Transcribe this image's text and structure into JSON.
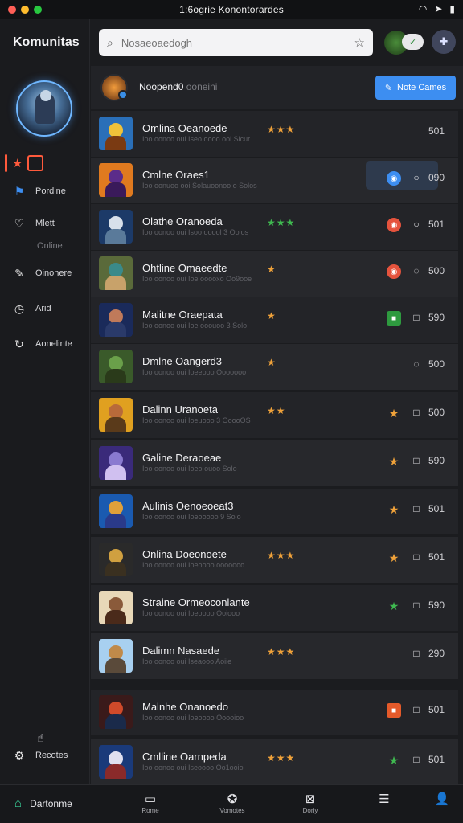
{
  "statusbar": {
    "title": "1:6ogrie Konontorardes"
  },
  "sidebar": {
    "title": "Komunitas",
    "items": [
      {
        "label": "Pordine",
        "icon": "flag-icon"
      },
      {
        "label": "Mlett",
        "icon": "heart-icon"
      },
      {
        "label": "Oinonere",
        "icon": "chat-icon"
      },
      {
        "label": "Arid",
        "icon": "clock-icon"
      },
      {
        "label": "Aonelinte",
        "icon": "refresh-icon"
      },
      {
        "label": "Recotes",
        "icon": "settings-icon"
      }
    ],
    "sub_label": "Online"
  },
  "search": {
    "placeholder": "Nosaeoaedogh"
  },
  "profile": {
    "name": "Noopend0",
    "status": "ooneini",
    "button_label": "Note Cames"
  },
  "rows": [
    {
      "title": "Omlina Oeanoede",
      "subtitle": "Ioo oonoo oui Iseo oooo ooi Sicur",
      "stars": "★★★",
      "star_color": "#f0a23a",
      "marker": "",
      "marker_color": "",
      "action": "",
      "count": "501"
    },
    {
      "title": "Cmlne Oraes1",
      "subtitle": "Ioo oonuoo ooi Solauoonoo o Solos",
      "stars": "",
      "star_color": "#f0a23a",
      "marker": "◉",
      "marker_color": "#3d8ef1",
      "action": "○",
      "count": "090"
    },
    {
      "title": "Olathe Oranoeda",
      "subtitle": "Ioo oonoo oui Isoo ooool 3 Ooios",
      "stars": "★★★",
      "star_color": "#3fb950",
      "marker": "◉",
      "marker_color": "#e5533d",
      "action": "○",
      "count": "501"
    },
    {
      "title": "Ohtline Omaeedte",
      "subtitle": "Ioo oonoo oui Ioe ooooxo Oo9ooe",
      "stars": "★",
      "star_color": "#f0a23a",
      "marker": "◉",
      "marker_color": "#e5533d",
      "action": "◌",
      "count": "500"
    },
    {
      "title": "Malitne Oraepata",
      "subtitle": "Ioo oonoo oui Ioe ooouoo 3 Solo",
      "stars": "★",
      "star_color": "#f0a23a",
      "marker": "■",
      "marker_color": "#2e9a3f",
      "action": "□",
      "count": "590"
    },
    {
      "title": "Dmlne Oangerd3",
      "subtitle": "Ioo oonoo oui Ioeeooo Ooooooo",
      "stars": "★",
      "star_color": "#f0a23a",
      "marker": "",
      "marker_color": "",
      "action": "◌",
      "count": "500"
    },
    {
      "title": "Dalinn Uranoeta",
      "subtitle": "Ioo oonoo oui Ioeuooo 3 OoooOS",
      "stars": "★★",
      "star_color": "#f0a23a",
      "marker": "★",
      "marker_color": "#f0a23a",
      "action": "□",
      "count": "500"
    },
    {
      "title": "Galine Deraoeae",
      "subtitle": "Ioo oonoo oui Ioeo ouoo Solo",
      "stars": "",
      "star_color": "#f0a23a",
      "marker": "★",
      "marker_color": "#f0a23a",
      "action": "□",
      "count": "590"
    },
    {
      "title": "Aulinis Oenoeoeat3",
      "subtitle": "Ioo oonoo oui Ioeooooo 9 Solo",
      "stars": "",
      "star_color": "#f0a23a",
      "marker": "★",
      "marker_color": "#f0a23a",
      "action": "□",
      "count": "501"
    },
    {
      "title": "Onlina Doeonoete",
      "subtitle": "Ioo oonoo oui Ioeoooo ooooooo",
      "stars": "★★★",
      "star_color": "#f0a23a",
      "marker": "★",
      "marker_color": "#f0a23a",
      "action": "□",
      "count": "501"
    },
    {
      "title": "Straine Ormeoconlante",
      "subtitle": "Ioo oonoo oui Ioeoooo Ooiooo",
      "stars": "",
      "star_color": "#f0a23a",
      "marker": "★",
      "marker_color": "#3fb950",
      "action": "□",
      "count": "590"
    },
    {
      "title": "Dalimn Nasaede",
      "subtitle": "Ioo oonoo oui Iseaooo Aoiie",
      "stars": "★★★",
      "star_color": "#f0a23a",
      "marker": "",
      "marker_color": "",
      "action": "□",
      "count": "290"
    },
    {
      "title": "Malnhe Onanoedo",
      "subtitle": "Ioo oonoo oui Ioeoooo Ooooioo",
      "stars": "",
      "star_color": "#f0a23a",
      "marker": "■",
      "marker_color": "#e55a2a",
      "action": "□",
      "count": "501"
    },
    {
      "title": "Cmlline Oarnpeda",
      "subtitle": "Ioo oonoo oui Iseoooo Oo1ooio",
      "stars": "★★★",
      "star_color": "#f0a23a",
      "marker": "★",
      "marker_color": "#3fb950",
      "action": "□",
      "count": "501"
    }
  ],
  "thumb_colors": [
    [
      "#2a6fb8",
      "#f0c23a",
      "#7a3a12"
    ],
    [
      "#e07a1f",
      "#5b2c8a",
      "#3a1a5a"
    ],
    [
      "#1c3a68",
      "#d8e0ea",
      "#5a7a9a"
    ],
    [
      "#5a6a3a",
      "#3a8a8a",
      "#c8a26a"
    ],
    [
      "#1a2a5a",
      "#c07a5a",
      "#2a3a6a"
    ],
    [
      "#3a5a2a",
      "#6aa04a",
      "#2a3a1a"
    ],
    [
      "#e0a020",
      "#b86a3a",
      "#5a3a1a"
    ],
    [
      "#3a2a7a",
      "#8a7ad0",
      "#d0c0f0"
    ],
    [
      "#1a5ab0",
      "#e0a03a",
      "#2a3a8a"
    ],
    [
      "#2a2a2a",
      "#d0a040",
      "#3a3020"
    ],
    [
      "#e8d8b8",
      "#8a5a3a",
      "#4a2a1a"
    ],
    [
      "#a8d0f0",
      "#c08a4a",
      "#5a4a3a"
    ],
    [
      "#3a1a1a",
      "#d04a2a",
      "#1a2a4a"
    ],
    [
      "#1a3a7a",
      "#e0e0f0",
      "#8a2a2a"
    ]
  ],
  "bottomnav": {
    "home_label": "Dartonme",
    "items": [
      {
        "label": "Rome",
        "icon": "tablet-icon"
      },
      {
        "label": "Vomotes",
        "icon": "game-icon"
      },
      {
        "label": "Doriy",
        "icon": "inbox-icon"
      },
      {
        "label": "",
        "icon": "list-icon"
      },
      {
        "label": "",
        "icon": "profile-icon"
      }
    ]
  },
  "colors": {
    "accent": "#3d8ef1",
    "active": "#ff5a3c",
    "background": "#1b1c1f",
    "row": "#232428"
  }
}
